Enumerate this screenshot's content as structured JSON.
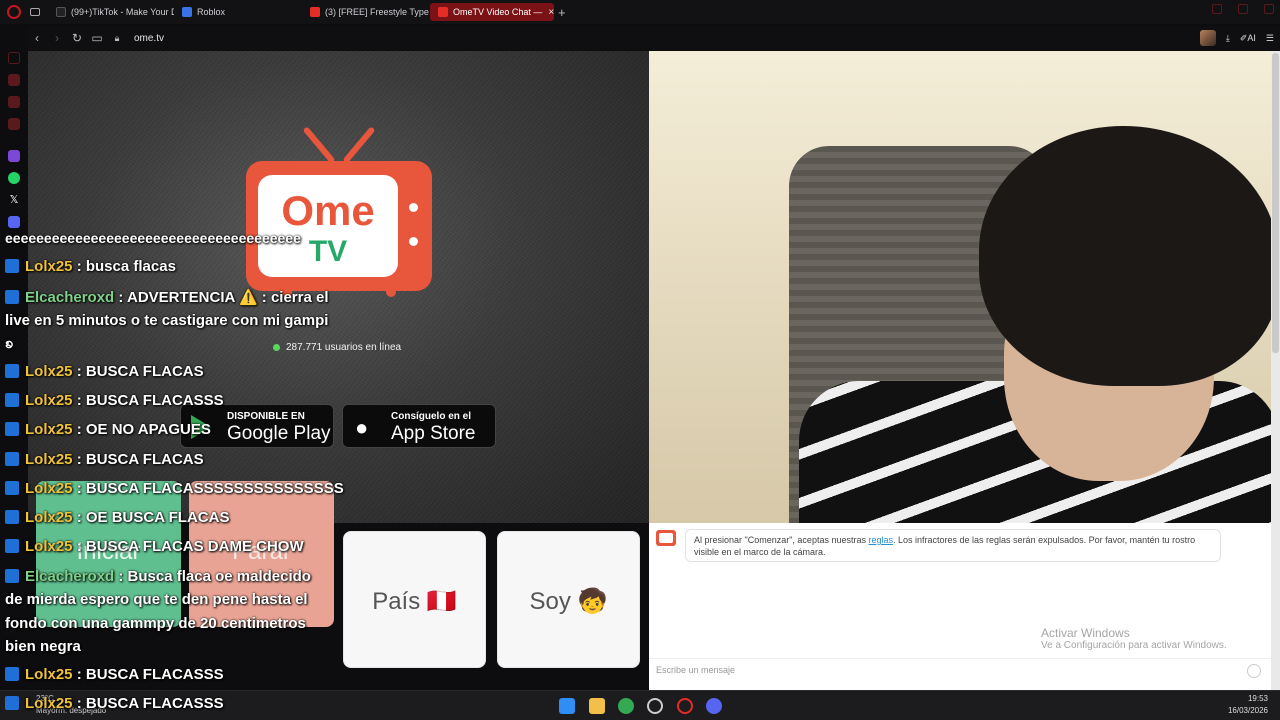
{
  "browser": {
    "tabs": [
      {
        "label": "(99+)TikTok - Make Your D",
        "icon_color": "#111111"
      },
      {
        "label": "Roblox",
        "icon_color": "#3a73e8"
      },
      {
        "label": "(3) [FREE] Freestyle Type",
        "icon_color": "#e52d27"
      },
      {
        "label": "OmeTV Video Chat —",
        "icon_color": "#e52d27",
        "active": true
      }
    ],
    "url": "ome.tv",
    "ai_label": "AI"
  },
  "ometv": {
    "logo_top": "Ome",
    "logo_bottom": "TV",
    "online_count": "287.771 usuarios en línea",
    "google_play": {
      "small": "DISPONIBLE EN",
      "big": "Google Play"
    },
    "app_store": {
      "small": "Consíguelo en el",
      "big": "App Store"
    },
    "buttons": {
      "start": "Iniciar",
      "stop": "Parar",
      "country": "País 🇵🇪",
      "gender": "Soy 🧒"
    },
    "notice_before": "Al presionar \"Comenzar\", aceptas nuestras ",
    "notice_link": "reglas",
    "notice_after": ". Los infractores de las reglas serán expulsados. Por favor, mantén tu rostro visible en el marco de la cámara.",
    "message_placeholder": "Escribe un mensaje",
    "activate_title": "Activar Windows",
    "activate_sub": "Ve a Configuración para activar Windows."
  },
  "stream_chat": [
    {
      "text": "eeeeeeeeeeeeeeeeeeeeeeeeeeeeeeeeeeeeee"
    },
    {
      "user": "Lolx25",
      "text": " : busca flacas"
    },
    {
      "user": "Elcacheroxd",
      "text": " : ADVERTENCIA ⚠️ : cierra el"
    },
    {
      "text": "live en 5 minutos o te castigare con mi gampi"
    },
    {
      "text": "ꧠ"
    },
    {
      "user": "Lolx25",
      "text": " : BUSCA FLACAS"
    },
    {
      "user": "Lolx25",
      "text": " : BUSCA FLACASSS"
    },
    {
      "user": "Lolx25",
      "text": " : OE NO APAGUES"
    },
    {
      "user": "Lolx25",
      "text": " : BUSCA FLACAS"
    },
    {
      "user": "Lolx25",
      "text": " : BUSCA FLACASSSSSSSSSSSSSSS"
    },
    {
      "user": "Lolx25",
      "text": " : OE BUSCA FLACAS"
    },
    {
      "user": "Lolx25",
      "text": " : BUSCA FLACAS DAME CHOW"
    },
    {
      "user": "Elcacheroxd",
      "text": " : Busca flaca oe maldecido"
    },
    {
      "text": "de mierda espero que te den pene hasta el"
    },
    {
      "text": "fondo con una gammpy de 20 centimetros"
    },
    {
      "text": "bien negra"
    },
    {
      "user": "Lolx25",
      "text": " : BUSCA FLACASSS"
    },
    {
      "user": "Lolx25",
      "text": " : BUSCA FLACASSS"
    }
  ],
  "taskbar": {
    "weather_temp": "23°C",
    "weather_desc": "Mayorm. despejado",
    "time": "19:53",
    "date": "16/03/2026"
  },
  "colors": {
    "ometv_orange": "#e8573b",
    "ometv_green": "#26a86a",
    "start_green": "#5fbf8f",
    "stop_red": "#e9a394",
    "opera_red": "#c5161d"
  }
}
